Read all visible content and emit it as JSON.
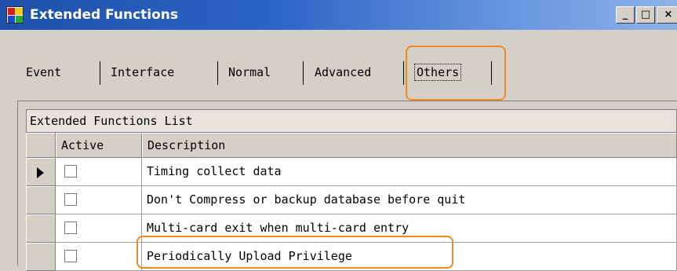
{
  "window": {
    "title": "Extended Functions",
    "controls": {
      "minimize": "_",
      "maximize": "□",
      "close": "×"
    }
  },
  "tabs": [
    {
      "label": "Event"
    },
    {
      "label": "Interface"
    },
    {
      "label": "Normal"
    },
    {
      "label": "Advanced"
    },
    {
      "label": "Others",
      "selected": true
    }
  ],
  "grid": {
    "title": "Extended Functions List",
    "columns": [
      "Active",
      "Description"
    ],
    "rows": [
      {
        "active": false,
        "description": "Timing collect data",
        "current": true
      },
      {
        "active": false,
        "description": "Don't Compress or backup database before quit"
      },
      {
        "active": false,
        "description": "Multi-card exit when multi-card entry"
      },
      {
        "active": false,
        "description": "Periodically Upload Privilege"
      }
    ]
  },
  "colors": {
    "highlight": "#f08a1e",
    "titlebar": "#1e50a9",
    "face": "#d4d0c8"
  }
}
